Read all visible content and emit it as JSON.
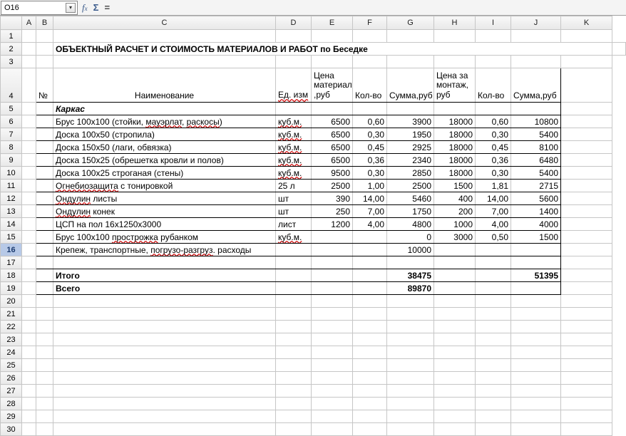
{
  "nameBox": "O16",
  "cols": [
    "A",
    "B",
    "C",
    "D",
    "E",
    "F",
    "G",
    "H",
    "I",
    "J",
    "K"
  ],
  "title": "ОБЪЕКТНЫЙ РАСЧЕТ И СТОИМОСТЬ МАТЕРИАЛОВ И РАБОТ по Беседке",
  "hdr": {
    "B": "№",
    "C": "Наименование",
    "D": "Ед. изм",
    "E": "Цена материалов ,руб",
    "F": "Кол-во",
    "G": "Сумма,руб",
    "H": "Цена  за монтаж, руб",
    "I": "Кол-во",
    "J": "Сумма,руб"
  },
  "sec": "Каркас",
  "rows": [
    {
      "c": "Брус 100х100  (стойки, мауэрлат, раскосы)",
      "d": "куб.м.",
      "e": "6500",
      "f": "0,60",
      "g": "3900",
      "h": "18000",
      "i": "0,60",
      "j": "10800"
    },
    {
      "c": "Доска 100х50  (стропила)",
      "d": "куб.м.",
      "e": "6500",
      "f": "0,30",
      "g": "1950",
      "h": "18000",
      "i": "0,30",
      "j": "5400"
    },
    {
      "c": "Доска 150х50 (лаги, обвязка)",
      "d": "куб.м.",
      "e": "6500",
      "f": "0,45",
      "g": "2925",
      "h": "18000",
      "i": "0,45",
      "j": "8100"
    },
    {
      "c": "Доска 150х25 (обрешетка кровли и полов)",
      "d": "куб.м.",
      "e": "6500",
      "f": "0,36",
      "g": "2340",
      "h": "18000",
      "i": "0,36",
      "j": "6480"
    },
    {
      "c": "Доска 100х25 строганая  (стены)",
      "d": "куб.м.",
      "e": "9500",
      "f": "0,30",
      "g": "2850",
      "h": "18000",
      "i": "0,30",
      "j": "5400"
    },
    {
      "c": "Огнебиозащита с тонировкой",
      "d": "25 л",
      "e": "2500",
      "f": "1,00",
      "g": "2500",
      "h": "1500",
      "i": "1,81",
      "j": "2715"
    },
    {
      "c": "Ондулин листы",
      "d": "шт",
      "e": "390",
      "f": "14,00",
      "g": "5460",
      "h": "400",
      "i": "14,00",
      "j": "5600"
    },
    {
      "c": "Ондулин  конек",
      "d": "шт",
      "e": "250",
      "f": "7,00",
      "g": "1750",
      "h": "200",
      "i": "7,00",
      "j": "1400"
    },
    {
      "c": "ЦСП на пол 16х1250х3000",
      "d": "лист",
      "e": "1200",
      "f": "4,00",
      "g": "4800",
      "h": "1000",
      "i": "4,00",
      "j": "4000"
    },
    {
      "c": "Брус 100х100 прострожка рубанком",
      "d": "куб.м.",
      "e": "",
      "f": "",
      "g": "0",
      "h": "3000",
      "i": "0,50",
      "j": "1500"
    },
    {
      "c": "Крепеж, транспортные, погрузо-разгруз. расходы",
      "d": "",
      "e": "",
      "f": "",
      "g": "10000",
      "h": "",
      "i": "",
      "j": ""
    }
  ],
  "totals": {
    "itogo_label": "Итого",
    "itogo_g": "38475",
    "itogo_j": "51395",
    "vsego_label": "Всего",
    "vsego_g": "89870"
  }
}
